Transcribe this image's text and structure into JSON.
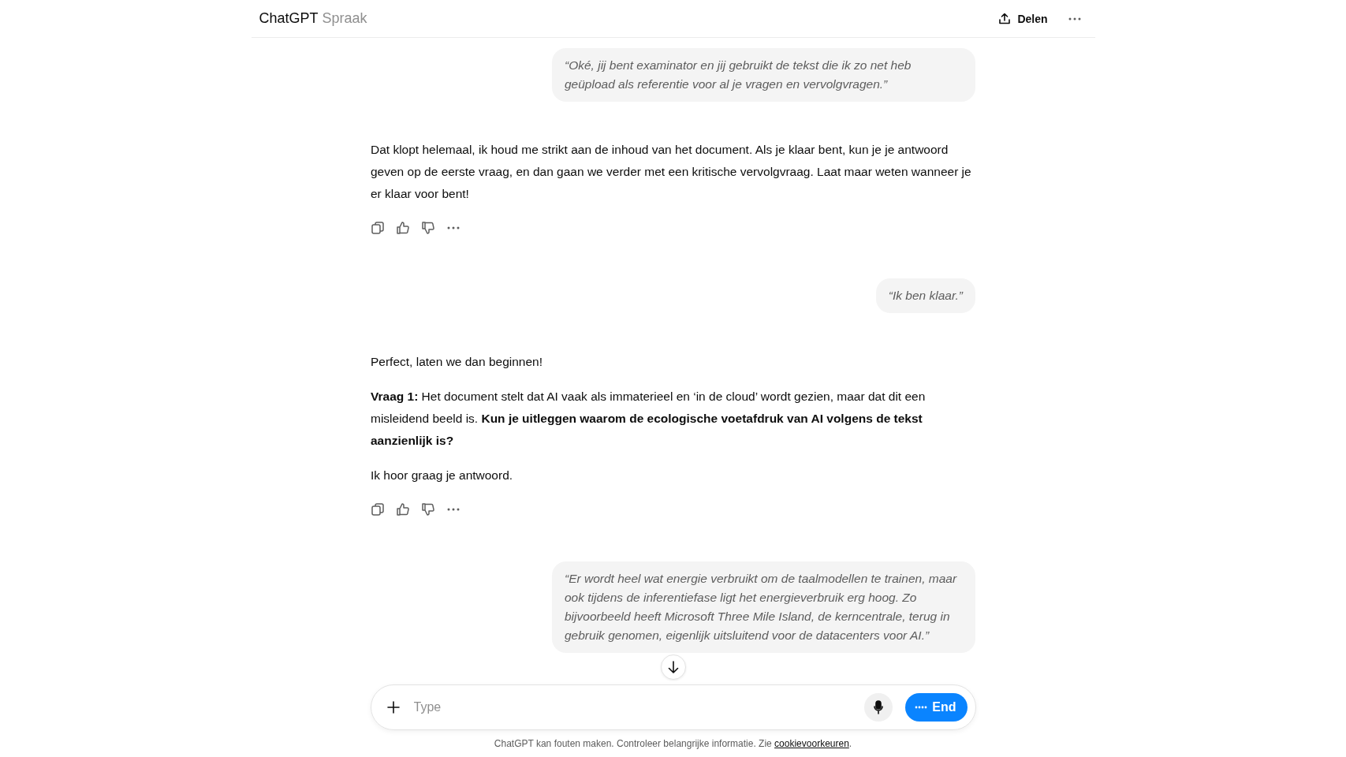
{
  "header": {
    "title": "ChatGPT",
    "subtitle": "Spraak",
    "share_label": "Delen"
  },
  "messages": [
    {
      "kind": "user",
      "text": "“Oké, jij bent examinator en jij gebruikt de tekst die ik zo net heb geüpload als referentie voor al je vragen en vervolgvragen.”"
    },
    {
      "kind": "assistant",
      "paragraphs": [
        "Dat klopt helemaal, ik houd me strikt aan de inhoud van het document. Als je klaar bent, kun je je antwoord geven op de eerste vraag, en dan gaan we verder met een kritische vervolgvraag. Laat maar weten wanneer je er klaar voor bent!"
      ]
    },
    {
      "kind": "user",
      "text": "“Ik ben klaar.”"
    },
    {
      "kind": "assistant",
      "paragraphs": [
        "Perfect, laten we dan beginnen!",
        "**Vraag 1:** Het document stelt dat AI vaak als immaterieel en ‘in de cloud’ wordt gezien, maar dat dit een misleidend beeld is. **Kun je uitleggen waarom de ecologische voetafdruk van AI volgens de tekst aanzienlijk is?**",
        "Ik hoor graag je antwoord."
      ]
    },
    {
      "kind": "user",
      "text": "“Er wordt heel wat energie verbruikt om de taalmodellen te trainen, maar ook tijdens de inferentiefase ligt het energieverbruik erg hoog. Zo bijvoorbeeld heeft Microsoft Three Mile Island, de kerncentrale, terug in gebruik genomen, eigenlijk uitsluitend voor de datacenters voor AI.”"
    }
  ],
  "composer": {
    "placeholder": "Type",
    "end_label": "End"
  },
  "footer": {
    "text": "ChatGPT kan fouten maken. Controleer belangrijke informatie. Zie ",
    "link": "cookievoorkeuren",
    "tail": "."
  }
}
